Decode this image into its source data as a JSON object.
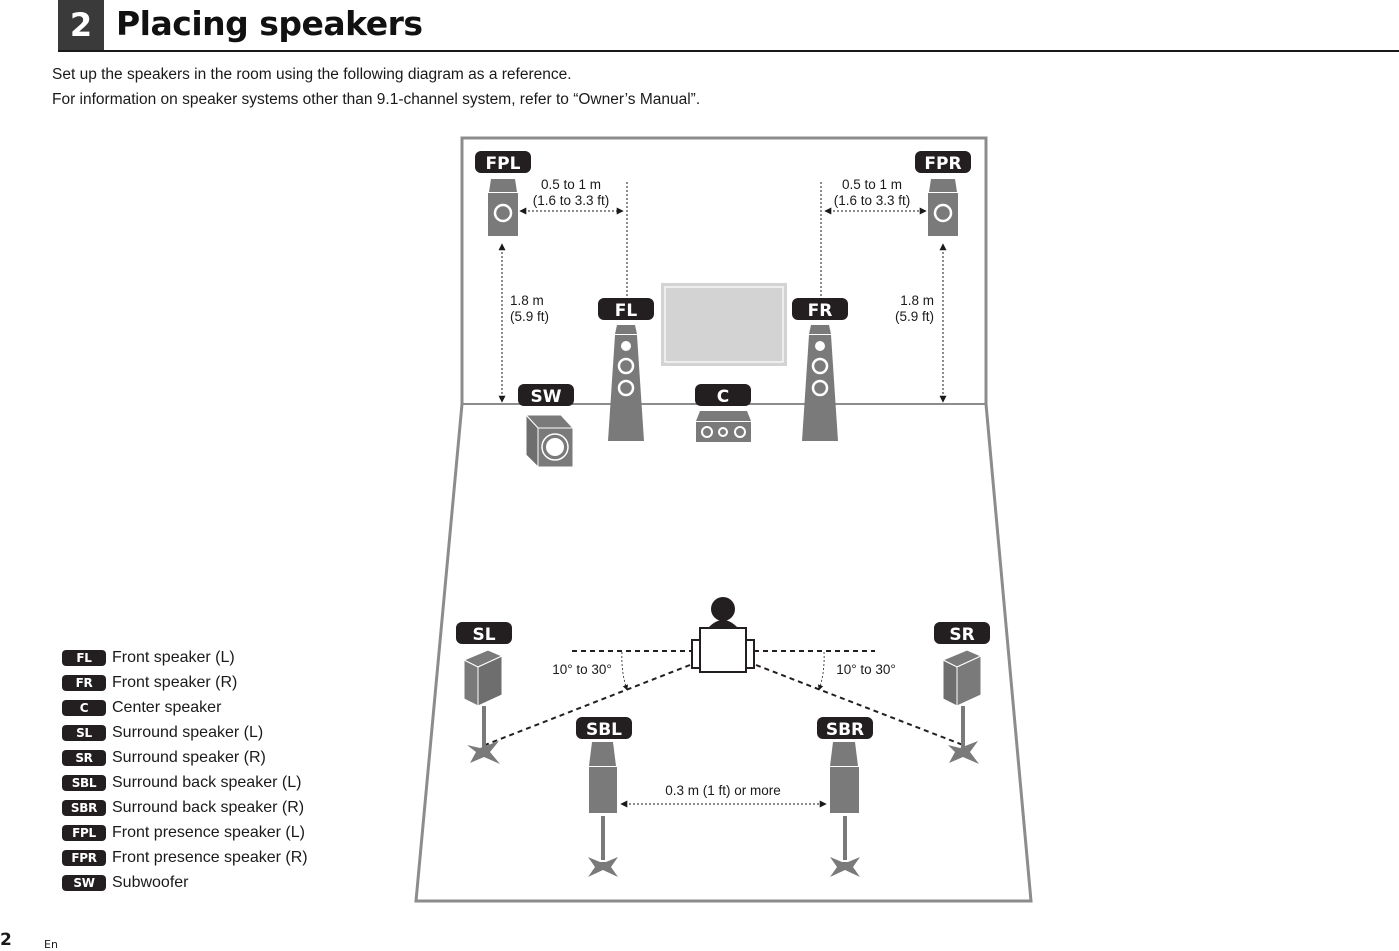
{
  "header": {
    "section_number": "2",
    "title": "Placing speakers"
  },
  "intro": {
    "line1": "Set up the speakers in the room using the following diagram as a reference.",
    "line2": "For information on speaker systems other than 9.1-channel system, refer to “Owner’s Manual”."
  },
  "diagram": {
    "speakers": {
      "FPL": "FPL",
      "FPR": "FPR",
      "FL": "FL",
      "FR": "FR",
      "C": "C",
      "SW": "SW",
      "SL": "SL",
      "SR": "SR",
      "SBL": "SBL",
      "SBR": "SBR"
    },
    "dimensions": {
      "fp_horizontal_m": "0.5 to 1 m",
      "fp_horizontal_ft": "(1.6 to 3.3 ft)",
      "fp_vertical_m": "1.8 m",
      "fp_vertical_ft": "(5.9 ft)",
      "surround_angle": "10° to 30°",
      "surround_back_gap": "0.3 m (1 ft) or more"
    },
    "colors": {
      "label_bg": "#231f20",
      "speaker_gray": "#7a7a7a",
      "room_outline": "#8c8c8c",
      "tv_fill": "#d3d3d3"
    }
  },
  "legend": [
    {
      "code": "FL",
      "text": "Front speaker (L)"
    },
    {
      "code": "FR",
      "text": "Front speaker (R)"
    },
    {
      "code": "C",
      "text": "Center speaker"
    },
    {
      "code": "SL",
      "text": "Surround speaker (L)"
    },
    {
      "code": "SR",
      "text": "Surround speaker (R)"
    },
    {
      "code": "SBL",
      "text": "Surround back speaker (L)"
    },
    {
      "code": "SBR",
      "text": "Surround back speaker (R)"
    },
    {
      "code": "FPL",
      "text": "Front presence speaker (L)"
    },
    {
      "code": "FPR",
      "text": "Front presence speaker (R)"
    },
    {
      "code": "SW",
      "text": "Subwoofer"
    }
  ],
  "footer": {
    "page_number": "2",
    "language": "En"
  }
}
